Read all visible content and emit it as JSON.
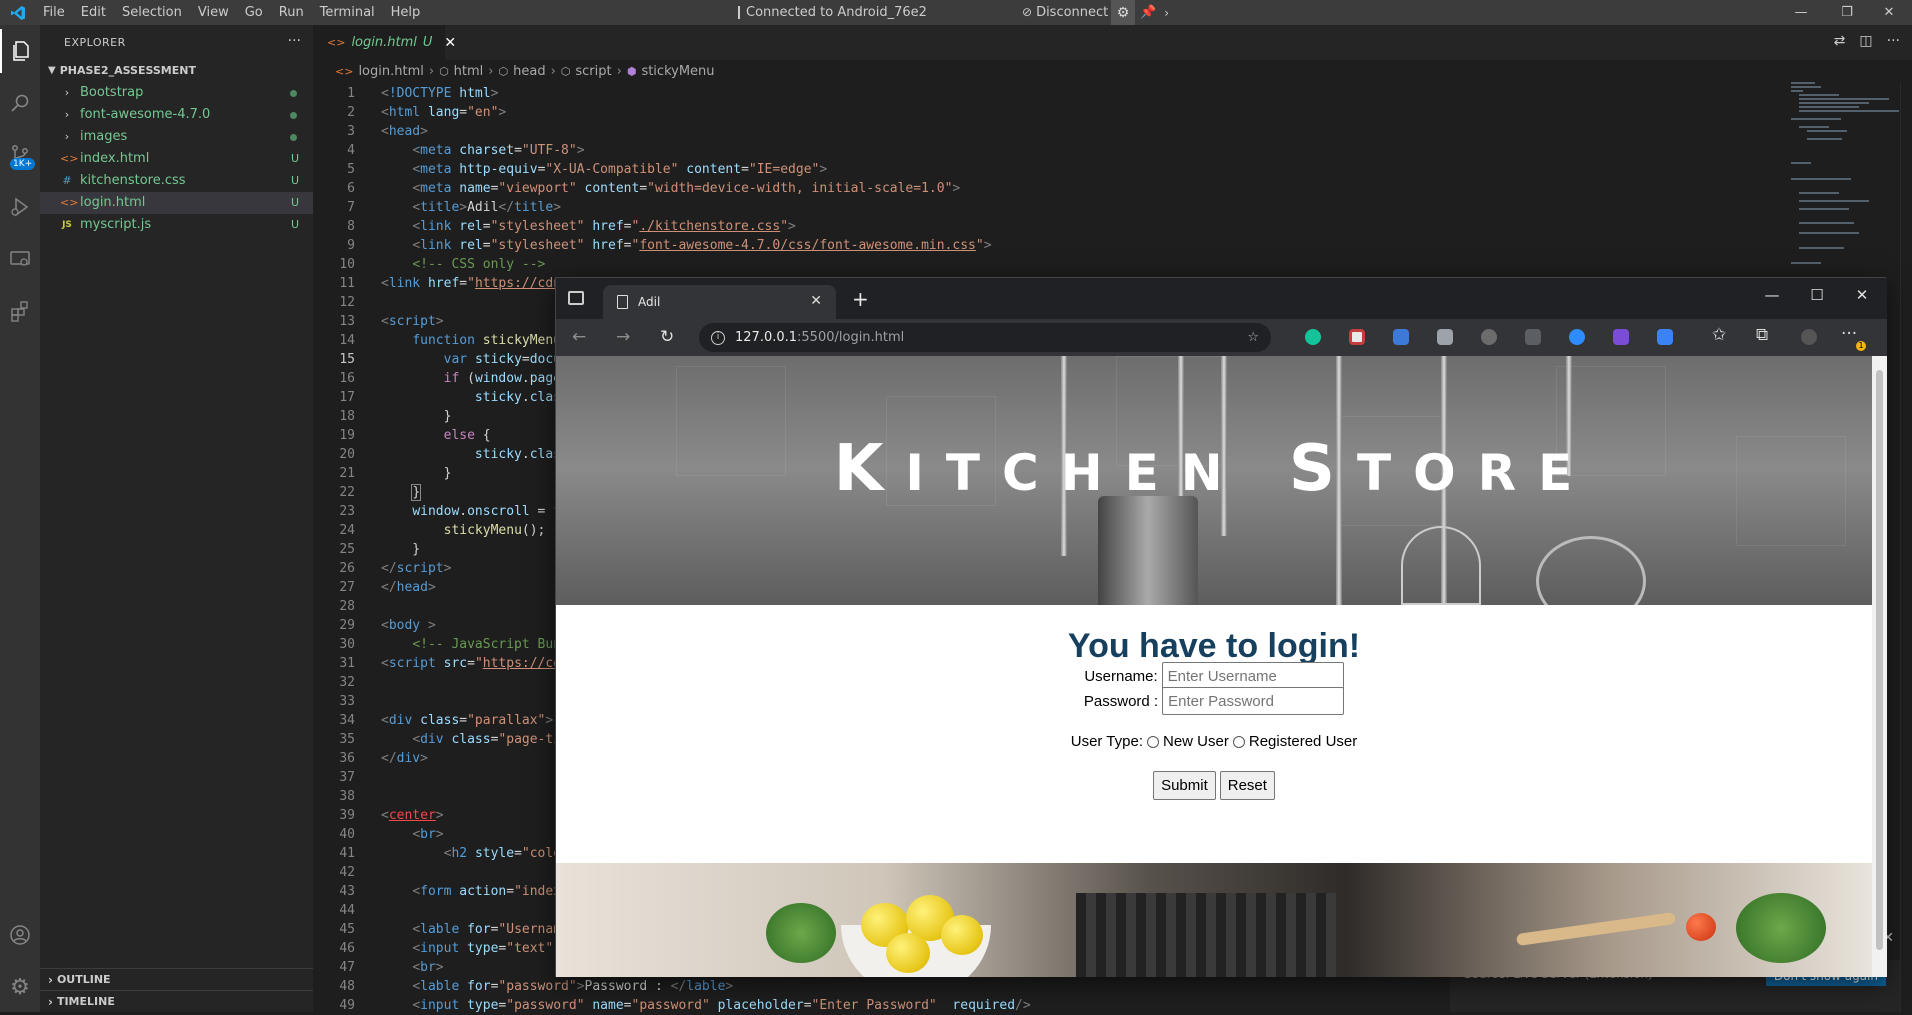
{
  "titlebar": {
    "menu": [
      "File",
      "Edit",
      "Selection",
      "View",
      "Go",
      "Run",
      "Terminal",
      "Help"
    ],
    "remote_status": "Connected to Android_76e2",
    "disconnect_label": "Disconnect"
  },
  "activity": {
    "scm_badge": "1K+"
  },
  "sidebar": {
    "title": "EXPLORER",
    "project": "PHASE2_ASSESSMENT",
    "items": [
      {
        "name": "Bootstrap",
        "type": "folder"
      },
      {
        "name": "font-awesome-4.7.0",
        "type": "folder"
      },
      {
        "name": "images",
        "type": "folder"
      },
      {
        "name": "index.html",
        "type": "html",
        "status": "U"
      },
      {
        "name": "kitchenstore.css",
        "type": "css",
        "status": "U"
      },
      {
        "name": "login.html",
        "type": "html",
        "status": "U"
      },
      {
        "name": "myscript.js",
        "type": "js",
        "status": "U"
      }
    ],
    "outline_label": "OUTLINE",
    "timeline_label": "TIMELINE"
  },
  "editor": {
    "tab_label": "login.html",
    "tab_status": "U",
    "breadcrumbs": [
      "login.html",
      "html",
      "head",
      "script",
      "stickyMenu"
    ],
    "current_line": 15
  },
  "browser": {
    "tab_title": "Adil",
    "url_host": "127.0.0.1",
    "url_path": ":5500/login.html",
    "extension_badge": "1",
    "page": {
      "hero_title_big1": "K",
      "hero_title_rest1": "ITCHEN",
      "hero_title_big2": "S",
      "hero_title_rest2": "TORE",
      "heading": "You have to login!",
      "username_label": "Username:",
      "username_placeholder": "Enter Username",
      "password_label": "Password :",
      "password_placeholder": "Enter Password",
      "usertype_label": "User Type:",
      "option_new": "New User",
      "option_registered": "Registered User",
      "submit_label": "Submit",
      "reset_label": "Reset"
    }
  },
  "notification": {
    "text": "Source: Live Server (Extension)",
    "button": "Don't show again"
  },
  "colors": {
    "accent": "#007acc",
    "git_untracked": "#73c991",
    "heading_blue": "#17405f"
  }
}
